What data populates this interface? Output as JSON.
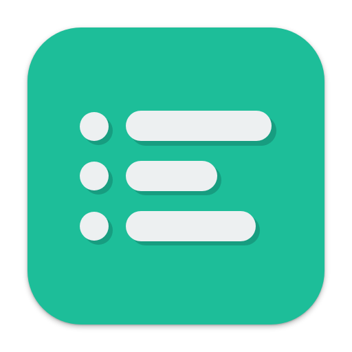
{
  "icon": {
    "name": "list-icon",
    "colors": {
      "background": "#1dbe99",
      "shadow": "#179d80",
      "foreground": "#edf0f1"
    },
    "rows": 3
  }
}
